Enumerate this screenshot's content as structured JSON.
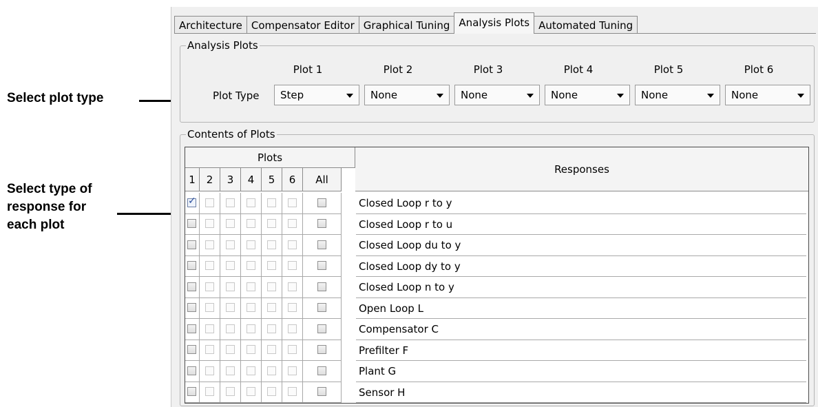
{
  "callouts": {
    "plot_type": "Select plot type",
    "response_line1": "Select type of",
    "response_line2": "response for",
    "response_line3": "each plot"
  },
  "tabs": [
    {
      "label": "Architecture",
      "active": false
    },
    {
      "label": "Compensator Editor",
      "active": false
    },
    {
      "label": "Graphical Tuning",
      "active": false
    },
    {
      "label": "Analysis Plots",
      "active": true
    },
    {
      "label": "Automated Tuning",
      "active": false
    }
  ],
  "analysis_plots": {
    "group_title": "Analysis Plots",
    "plot_type_label": "Plot Type",
    "plots": [
      {
        "header": "Plot 1",
        "value": "Step"
      },
      {
        "header": "Plot 2",
        "value": "None"
      },
      {
        "header": "Plot 3",
        "value": "None"
      },
      {
        "header": "Plot 4",
        "value": "None"
      },
      {
        "header": "Plot 5",
        "value": "None"
      },
      {
        "header": "Plot 6",
        "value": "None"
      }
    ]
  },
  "contents": {
    "group_title": "Contents of Plots",
    "plots_header": "Plots",
    "responses_header": "Responses",
    "columns": [
      "1",
      "2",
      "3",
      "4",
      "5",
      "6",
      "All"
    ],
    "rows": [
      {
        "label": "Closed Loop r to y",
        "checked": [
          true,
          false,
          false,
          false,
          false,
          false,
          false
        ]
      },
      {
        "label": "Closed Loop r to u",
        "checked": [
          false,
          false,
          false,
          false,
          false,
          false,
          false
        ]
      },
      {
        "label": "Closed Loop du to y",
        "checked": [
          false,
          false,
          false,
          false,
          false,
          false,
          false
        ]
      },
      {
        "label": "Closed Loop dy to y",
        "checked": [
          false,
          false,
          false,
          false,
          false,
          false,
          false
        ]
      },
      {
        "label": "Closed Loop n to y",
        "checked": [
          false,
          false,
          false,
          false,
          false,
          false,
          false
        ]
      },
      {
        "label": "Open Loop L",
        "checked": [
          false,
          false,
          false,
          false,
          false,
          false,
          false
        ]
      },
      {
        "label": "Compensator C",
        "checked": [
          false,
          false,
          false,
          false,
          false,
          false,
          false
        ]
      },
      {
        "label": "Prefilter F",
        "checked": [
          false,
          false,
          false,
          false,
          false,
          false,
          false
        ]
      },
      {
        "label": "Plant G",
        "checked": [
          false,
          false,
          false,
          false,
          false,
          false,
          false
        ]
      },
      {
        "label": "Sensor H",
        "checked": [
          false,
          false,
          false,
          false,
          false,
          false,
          false
        ]
      }
    ]
  }
}
